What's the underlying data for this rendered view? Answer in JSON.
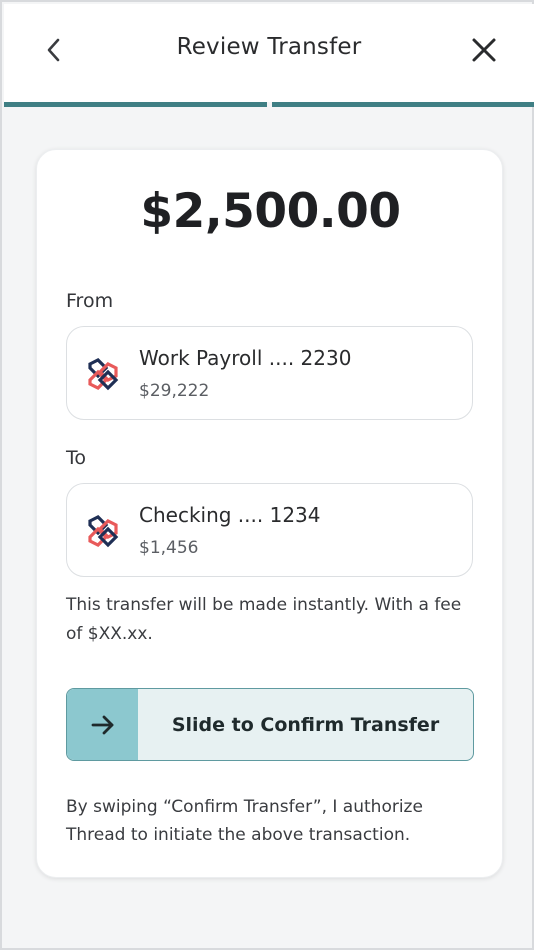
{
  "header": {
    "title": "Review Transfer",
    "back_icon": "chevron-left-icon",
    "close_icon": "close-icon"
  },
  "progress": {
    "steps_total": 2,
    "steps_completed": 2,
    "color": "#3f7f84"
  },
  "transfer": {
    "amount": "$2,500.00",
    "from_label": "From",
    "from": {
      "name": "Work Payroll .... 2230",
      "balance": "$29,222",
      "icon": "bank-logo-icon"
    },
    "to_label": "To",
    "to": {
      "name": "Checking .... 1234",
      "balance": "$1,456",
      "icon": "bank-logo-icon"
    },
    "note": "This transfer will be made instantly. With a fee of $XX.xx."
  },
  "confirm": {
    "slider_label": "Slide to Confirm Transfer",
    "handle_icon": "arrow-right-icon",
    "accent": "#8cc8cf",
    "track": "#e7f1f2"
  },
  "authorization": "By swiping “Confirm Transfer”, I authorize Thread to initiate the above transaction."
}
